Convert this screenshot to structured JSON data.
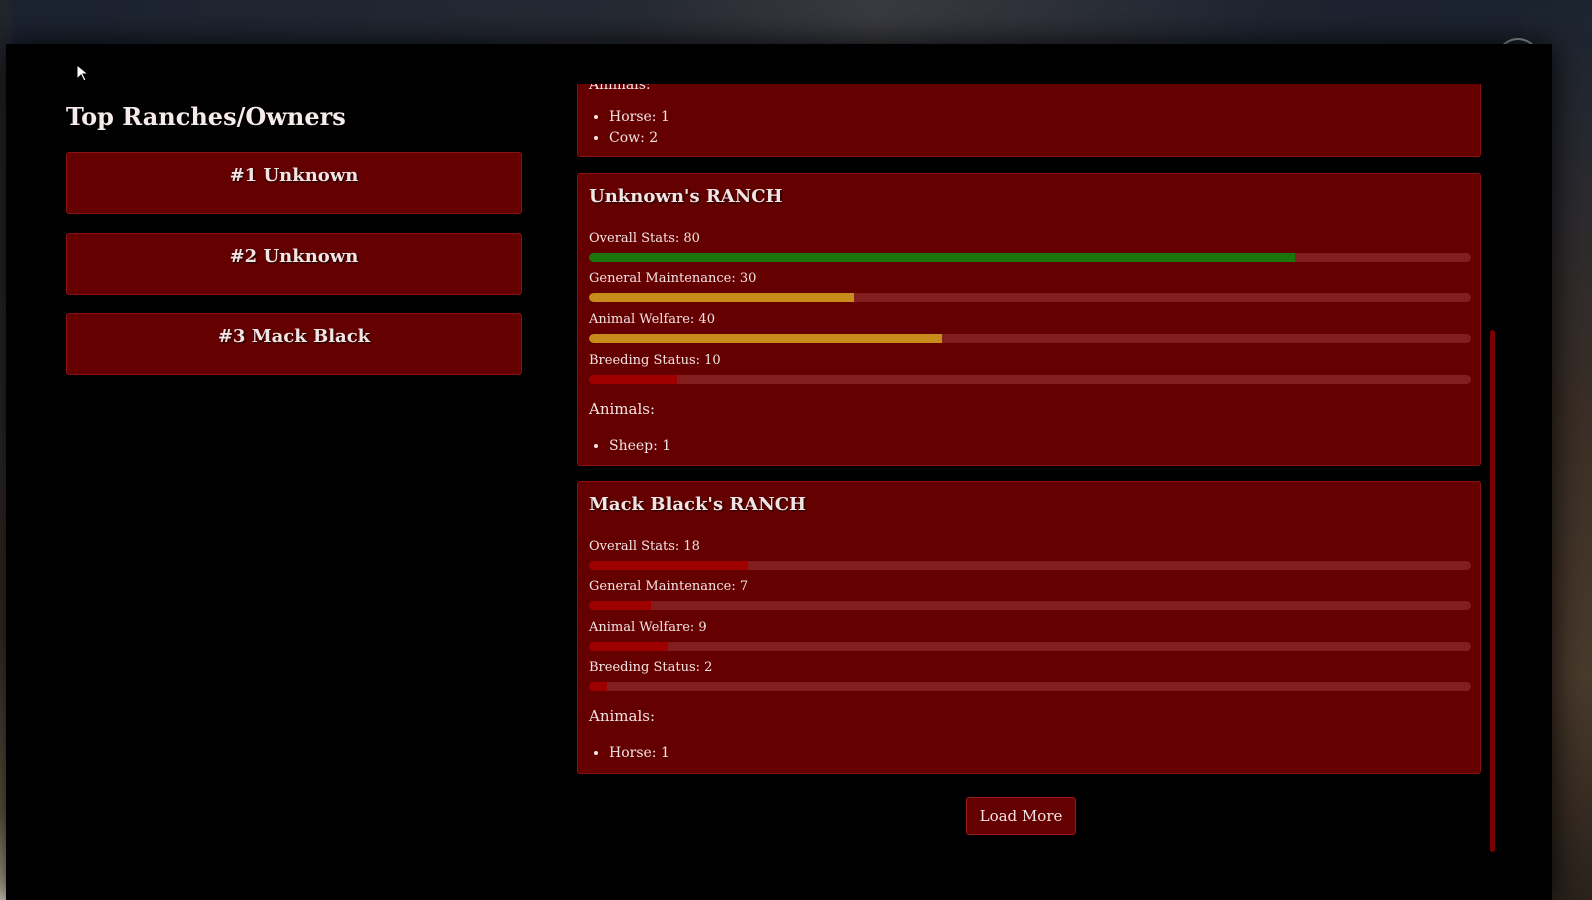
{
  "leaderboard": {
    "title": "Top Ranches/Owners",
    "entries": [
      {
        "label": "#1 Unknown"
      },
      {
        "label": "#2 Unknown"
      },
      {
        "label": "#3 Mack Black"
      }
    ]
  },
  "ranches": [
    {
      "title": "",
      "partial_label": "Animals:",
      "animals": [
        "Horse: 1",
        "Cow: 2"
      ]
    },
    {
      "title": "Unknown's RANCH",
      "stats": [
        {
          "label": "Overall Stats: 80",
          "value": 80,
          "color": "#0f8a0f"
        },
        {
          "label": "General Maintenance: 30",
          "value": 30,
          "color": "#daa520"
        },
        {
          "label": "Animal Welfare: 40",
          "value": 40,
          "color": "#daa520"
        },
        {
          "label": "Breeding Status: 10",
          "value": 10,
          "color": "#a80000"
        }
      ],
      "animals_label": "Animals:",
      "animals": [
        "Sheep: 1"
      ]
    },
    {
      "title": "Mack Black's RANCH",
      "stats": [
        {
          "label": "Overall Stats: 18",
          "value": 18,
          "color": "#a80000"
        },
        {
          "label": "General Maintenance: 7",
          "value": 7,
          "color": "#a80000"
        },
        {
          "label": "Animal Welfare: 9",
          "value": 9,
          "color": "#a80000"
        },
        {
          "label": "Breeding Status: 2",
          "value": 2,
          "color": "#a80000"
        }
      ],
      "animals_label": "Animals:",
      "animals": [
        "Horse: 1"
      ]
    }
  ],
  "load_more_label": "Load More",
  "colors": {
    "card_bg": "#650000",
    "track": "#8a2323",
    "good": "#0f8a0f",
    "medium": "#daa520",
    "bad": "#a80000"
  }
}
